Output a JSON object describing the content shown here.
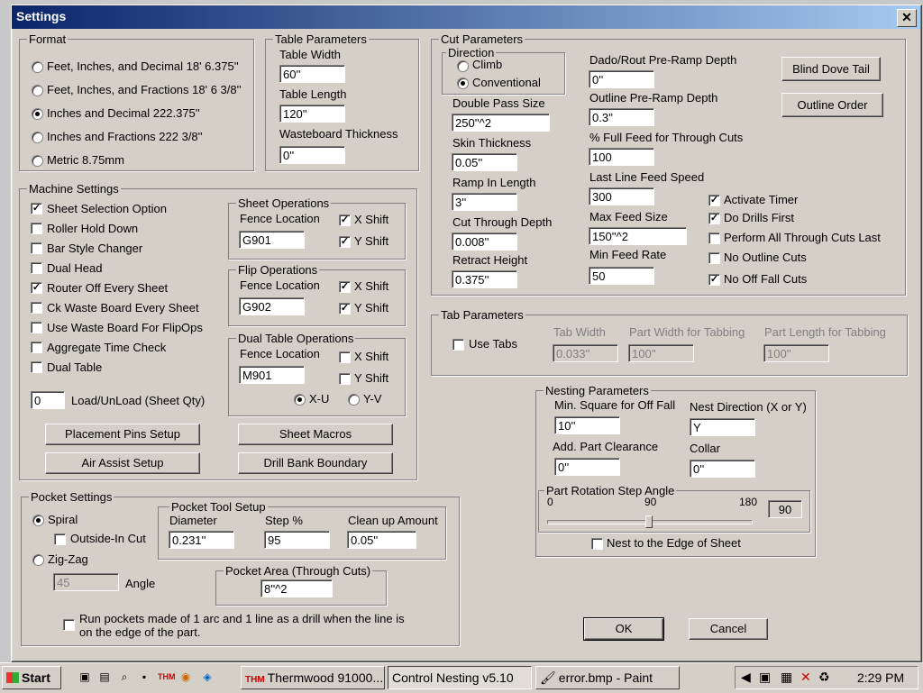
{
  "window": {
    "title": "Settings",
    "close": "✕"
  },
  "format": {
    "legend": "Format",
    "options": [
      {
        "label": "Feet, Inches, and Decimal 18' 6.375''",
        "selected": false
      },
      {
        "label": "Feet, Inches, and Fractions 18' 6 3/8''",
        "selected": false
      },
      {
        "label": "Inches and Decimal 222.375''",
        "selected": true
      },
      {
        "label": "Inches and Fractions 222 3/8''",
        "selected": false
      },
      {
        "label": "Metric 8.75mm",
        "selected": false
      }
    ]
  },
  "table": {
    "legend": "Table Parameters",
    "width_label": "Table Width",
    "width": "60''",
    "length_label": "Table Length",
    "length": "120''",
    "wasteboard_label": "Wasteboard Thickness",
    "wasteboard": "0''"
  },
  "cut": {
    "legend": "Cut Parameters",
    "direction_legend": "Direction",
    "climb": "Climb",
    "conventional": "Conventional",
    "double_pass_label": "Double Pass Size",
    "double_pass": "250''^2",
    "skin_label": "Skin Thickness",
    "skin": "0.05''",
    "ramp_label": "Ramp In Length",
    "ramp": "3''",
    "cut_through_label": "Cut Through Depth",
    "cut_through": "0.008''",
    "retract_label": "Retract Height",
    "retract": "0.375''",
    "dado_label": "Dado/Rout Pre-Ramp Depth",
    "dado": "0''",
    "outline_ramp_label": "Outline Pre-Ramp Depth",
    "outline_ramp": "0.3''",
    "full_feed_label": "% Full Feed for Through Cuts",
    "full_feed": "100",
    "last_line_label": "Last Line Feed Speed",
    "last_line": "300",
    "max_feed_label": "Max Feed Size",
    "max_feed": "150''^2",
    "min_feed_label": "Min Feed Rate",
    "min_feed": "50",
    "blind_dove": "Blind Dove Tail",
    "outline_order": "Outline Order",
    "activate_timer": "Activate Timer",
    "do_drills": "Do Drills First",
    "through_last": "Perform All Through Cuts Last",
    "no_outline": "No Outline Cuts",
    "no_off_fall": "No Off Fall Cuts"
  },
  "machine": {
    "legend": "Machine Settings",
    "items": [
      {
        "label": "Sheet Selection Option",
        "checked": true
      },
      {
        "label": "Roller Hold Down",
        "checked": false
      },
      {
        "label": "Bar Style Changer",
        "checked": false
      },
      {
        "label": "Dual Head",
        "checked": false
      },
      {
        "label": "Router Off Every Sheet",
        "checked": true
      },
      {
        "label": "Ck Waste Board Every Sheet",
        "checked": false
      },
      {
        "label": "Use Waste Board For FlipOps",
        "checked": false
      },
      {
        "label": "Aggregate Time Check",
        "checked": false
      },
      {
        "label": "Dual Table",
        "checked": false
      }
    ],
    "load_value": "0",
    "load_label": "Load/UnLoad (Sheet Qty)",
    "placement_pins": "Placement Pins Setup",
    "sheet_macros": "Sheet Macros",
    "air_assist": "Air Assist Setup",
    "drill_bank": "Drill Bank Boundary"
  },
  "sheet_ops": {
    "legend": "Sheet Operations",
    "fence_label": "Fence Location",
    "fence": "G901",
    "xshift": "X Shift",
    "yshift": "Y Shift"
  },
  "flip_ops": {
    "legend": "Flip Operations",
    "fence_label": "Fence Location",
    "fence": "G902",
    "xshift": "X Shift",
    "yshift": "Y Shift"
  },
  "dual_ops": {
    "legend": "Dual Table Operations",
    "fence_label": "Fence Location",
    "fence": "M901",
    "xshift": "X Shift",
    "yshift": "Y Shift",
    "xu": "X-U",
    "yv": "Y-V"
  },
  "tab": {
    "legend": "Tab Parameters",
    "use_tabs": "Use Tabs",
    "width_label": "Tab Width",
    "width": "0.033''",
    "part_width_label": "Part Width for Tabbing",
    "part_width": "100''",
    "part_length_label": "Part Length for Tabbing",
    "part_length": "100''"
  },
  "nesting": {
    "legend": "Nesting Parameters",
    "min_square_label": "Min. Square for Off Fall",
    "min_square": "10''",
    "direction_label": "Nest Direction (X or Y)",
    "direction": "Y",
    "clearance_label": "Add. Part Clearance",
    "clearance": "0''",
    "collar_label": "Collar",
    "collar": "0''",
    "rotation_legend": "Part Rotation Step Angle",
    "tick0": "0",
    "tick90": "90",
    "tick180": "180",
    "rotation_value": "90",
    "rotation_fraction": 0.5,
    "edge_label": "Nest to the Edge of Sheet"
  },
  "pocket": {
    "legend": "Pocket Settings",
    "spiral": "Spiral",
    "outside_in": "Outside-In Cut",
    "zigzag": "Zig-Zag",
    "angle_value": "45",
    "angle_label": "Angle",
    "tool_legend": "Pocket Tool Setup",
    "diameter_label": "Diameter",
    "diameter": "0.231''",
    "step_label": "Step %",
    "step": "95",
    "cleanup_label": "Clean up Amount",
    "cleanup": "0.05''",
    "area_legend": "Pocket Area (Through Cuts)",
    "area": "8''^2",
    "run_line1": "Run pockets made of 1 arc and 1 line as a drill when the line is",
    "run_line2": "on the edge of the part."
  },
  "dialog": {
    "ok": "OK",
    "cancel": "Cancel"
  },
  "taskbar": {
    "start": "Start",
    "task1": "Thermwood 91000...",
    "task2": "Control Nesting v5.10",
    "task3": "error.bmp - Paint",
    "clock": "2:29 PM"
  }
}
